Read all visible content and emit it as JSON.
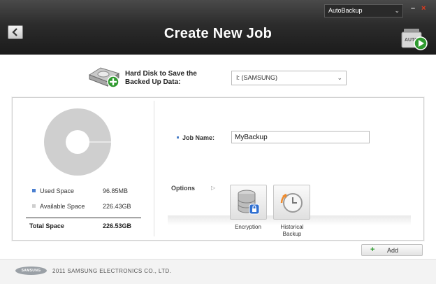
{
  "header": {
    "title": "Create New Job",
    "app_selector": "AutoBackup",
    "minimize": "–",
    "close": "×",
    "auto_icon_text": "AUTO"
  },
  "disk": {
    "label": "Hard Disk to Save the Backed Up Data:",
    "selected": "I: (SAMSUNG)"
  },
  "storage": {
    "used_fraction": 0.0004,
    "rows": [
      {
        "label": "Used Space",
        "value": "96.85MB",
        "color": "#4a7fd0"
      },
      {
        "label": "Available Space",
        "value": "226.43GB",
        "color": "#cfcfcf"
      }
    ],
    "total_label": "Total Space",
    "total_value": "226.53GB"
  },
  "job": {
    "name_label": "Job Name:",
    "name_value": "MyBackup"
  },
  "options": {
    "label": "Options",
    "encryption": "Encryption",
    "historical_line1": "Historical",
    "historical_line2": "Backup"
  },
  "add_button": "Add",
  "footer": {
    "logo": "SAMSUNG",
    "copyright": "2011 SAMSUNG ELECTRONICS CO., LTD."
  },
  "colors": {
    "header_dark": "#1b1b1b",
    "used_blue": "#4a7fd0",
    "available_gray": "#cfcfcf",
    "add_green": "#2f9a2f",
    "close_red": "#e03a1e"
  }
}
